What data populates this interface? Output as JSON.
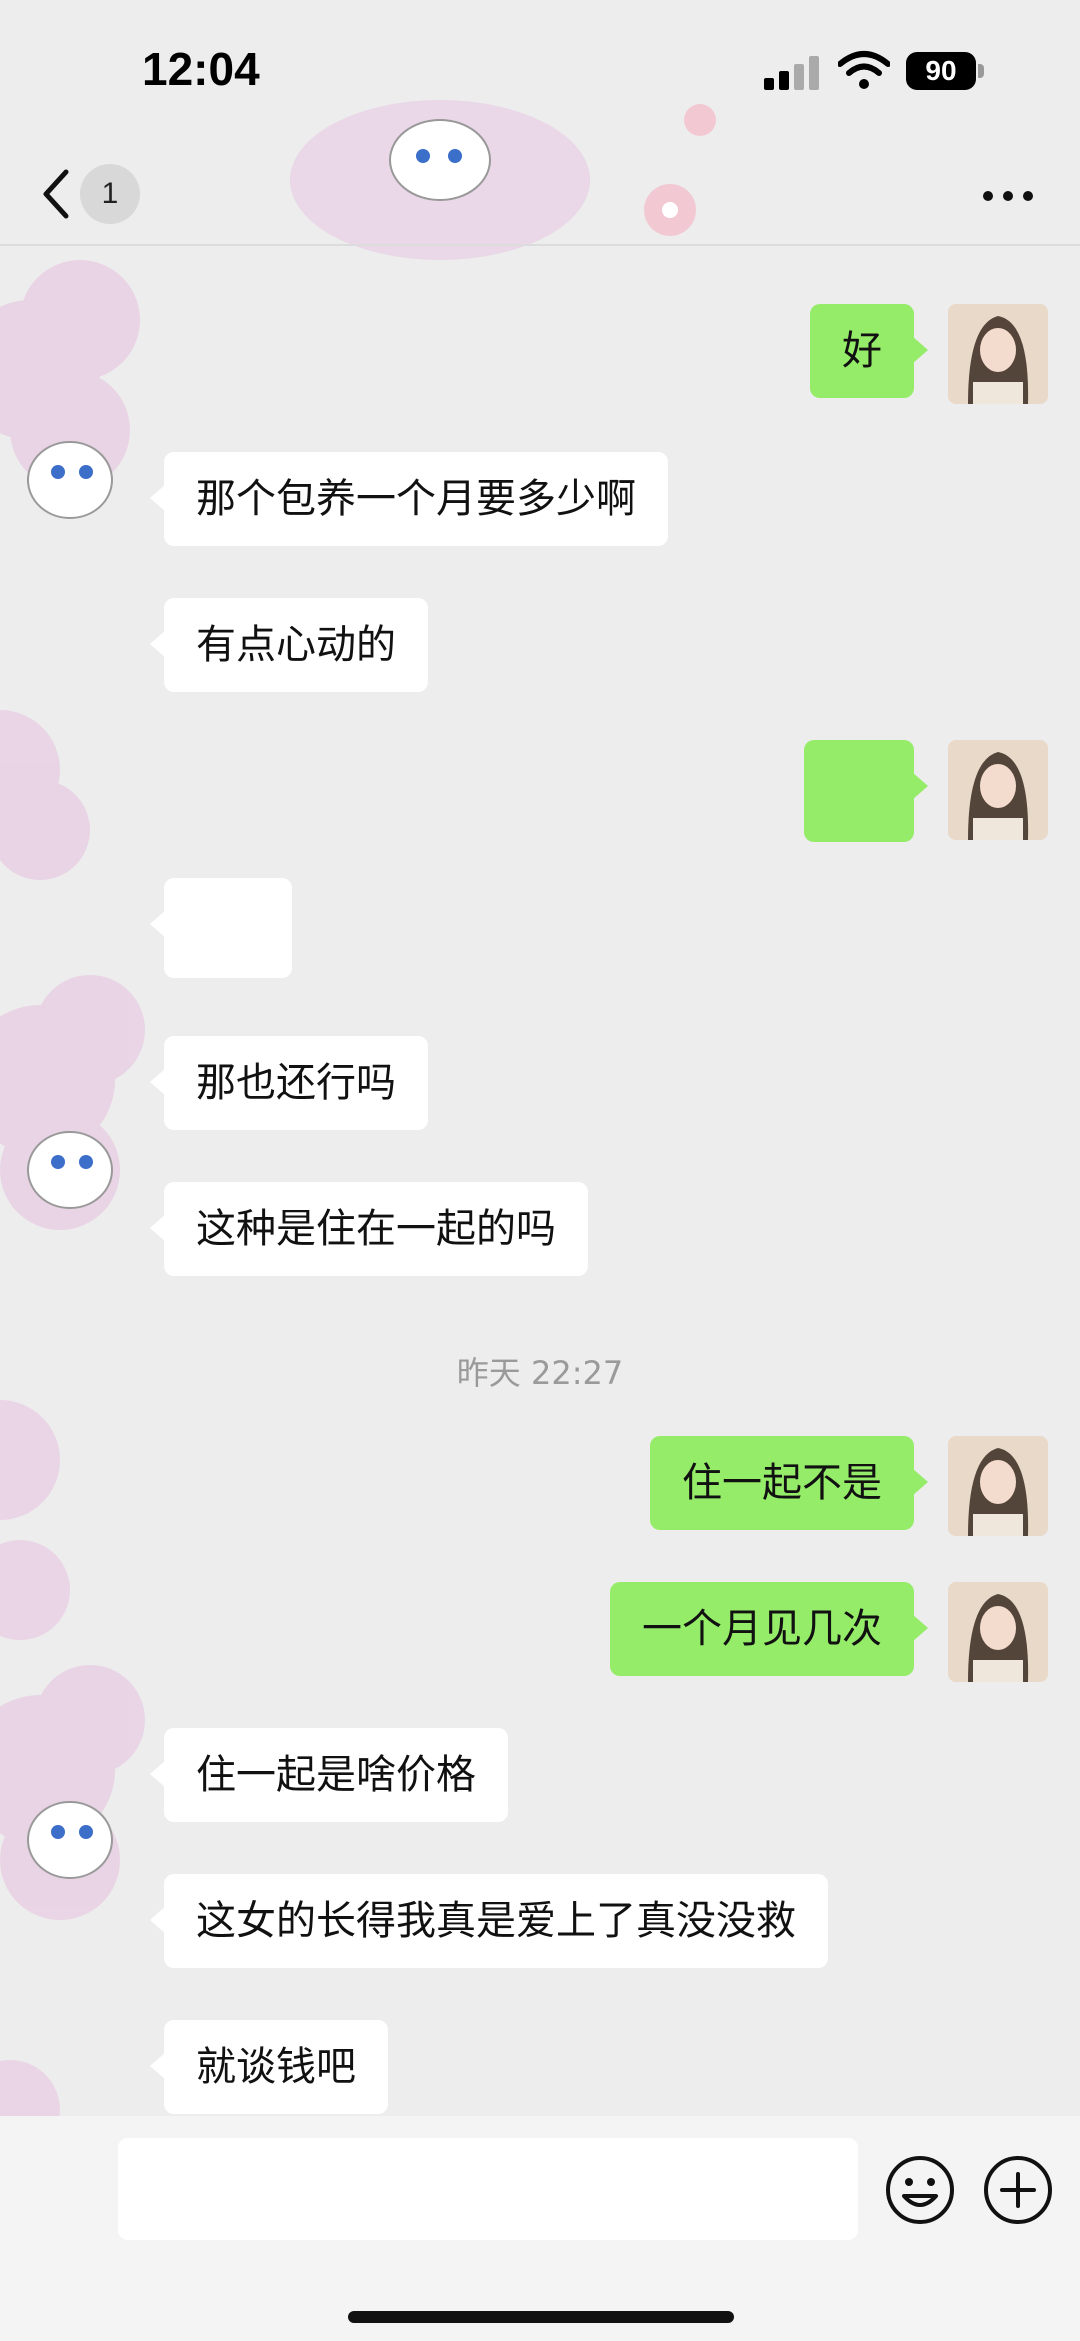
{
  "status_bar": {
    "time": "12:04",
    "battery": "90"
  },
  "nav": {
    "unread_count": "1"
  },
  "messages": [
    {
      "side": "out",
      "text": "好"
    },
    {
      "side": "in",
      "text": "那个包养一个月要多少啊"
    },
    {
      "side": "in",
      "text": "有点心动的"
    },
    {
      "side": "out",
      "text": ""
    },
    {
      "side": "in",
      "text": ""
    },
    {
      "side": "in",
      "text": "那也还行吗"
    },
    {
      "side": "in",
      "text": "这种是住在一起的吗"
    },
    {
      "side": "out",
      "text": "住一起不是"
    },
    {
      "side": "out",
      "text": "一个月见几次"
    },
    {
      "side": "in",
      "text": "住一起是啥价格"
    },
    {
      "side": "in",
      "text": "这女的长得我真是爱上了真没没救"
    },
    {
      "side": "in",
      "text": "就谈钱吧"
    }
  ],
  "timestamp": "昨天 22:27",
  "colors": {
    "outgoing_bubble": "#95ec69",
    "incoming_bubble": "#ffffff",
    "background": "#ededed"
  },
  "icons": [
    "back-icon",
    "more-icon",
    "emoji-icon",
    "plus-icon",
    "signal-icon",
    "wifi-icon",
    "battery-icon"
  ]
}
